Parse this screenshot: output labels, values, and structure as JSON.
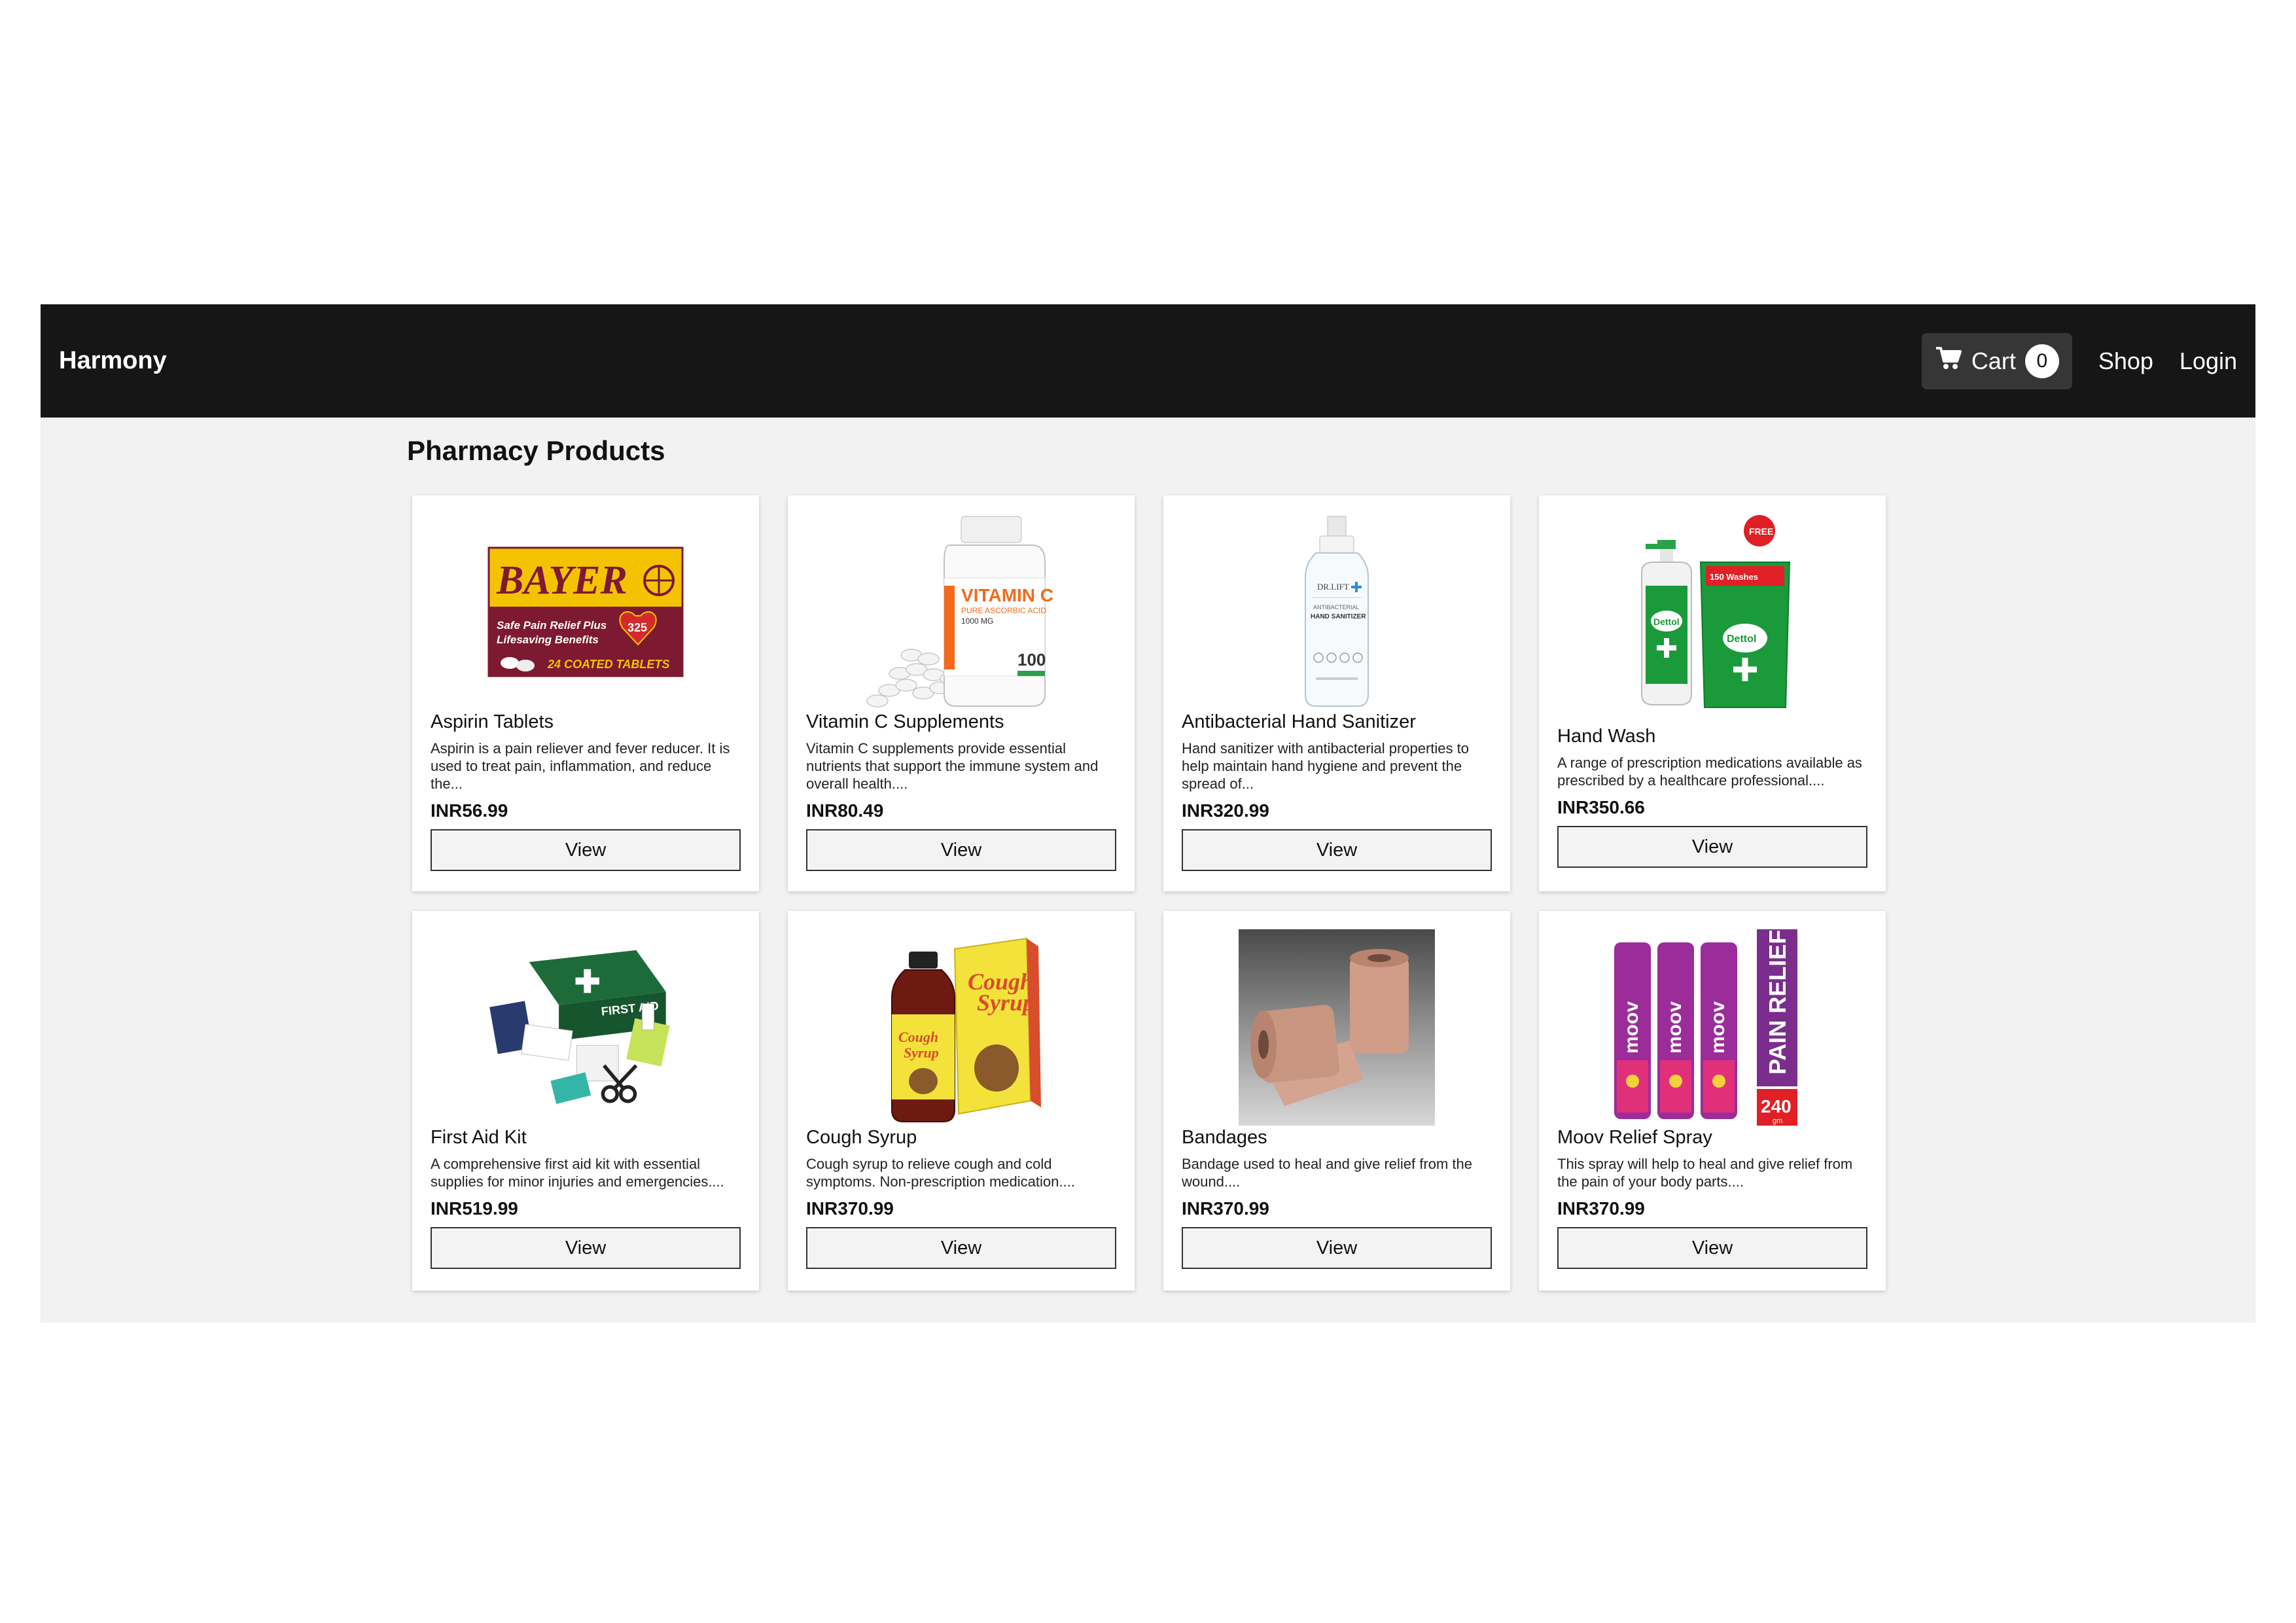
{
  "navbar": {
    "brand": "Harmony",
    "cart_label": "Cart",
    "cart_count": "0",
    "shop_label": "Shop",
    "login_label": "Login"
  },
  "page_title": "Pharmacy Products",
  "products": [
    {
      "name": "Aspirin Tablets",
      "description": "Aspirin is a pain reliever and fever reducer. It is used to treat pain, inflammation, and reduce the...",
      "price": "INR56.99",
      "view_label": "View",
      "image_text": {
        "brand": "BAYER",
        "line1": "Safe Pain Relief Plus",
        "line2": "Lifesaving Benefits",
        "strength": "325",
        "count": "24 COATED TABLETS"
      }
    },
    {
      "name": "Vitamin C Supplements",
      "description": "Vitamin C supplements provide essential nutrients that support the immune system and overall health....",
      "price": "INR80.49",
      "view_label": "View",
      "image_text": {
        "line1": "VITAMIN C",
        "line2": "PURE ASCORBIC ACID",
        "line3": "1000 MG",
        "count": "100"
      }
    },
    {
      "name": "Antibacterial Hand Sanitizer",
      "description": "Hand sanitizer with antibacterial properties to help maintain hand hygiene and prevent the spread of...",
      "price": "INR320.99",
      "view_label": "View",
      "image_text": {
        "brand": "DR.LIFT",
        "line1": "ANTIBACTERIAL",
        "line2": "HAND SANITIZER"
      }
    },
    {
      "name": "Hand Wash",
      "description": "A range of prescription medications available as prescribed by a healthcare professional....",
      "price": "INR350.66",
      "view_label": "View",
      "image_text": {
        "badge": "FREE",
        "brand": "Dettol",
        "washes": "150 Washes"
      }
    },
    {
      "name": "First Aid Kit",
      "description": "A comprehensive first aid kit with essential supplies for minor injuries and emergencies....",
      "price": "INR519.99",
      "view_label": "View",
      "image_text": {
        "label": "FIRST AID"
      }
    },
    {
      "name": "Cough Syrup",
      "description": "Cough syrup to relieve cough and cold symptoms. Non-prescription medication....",
      "price": "INR370.99",
      "view_label": "View",
      "image_text": {
        "line1": "Cough",
        "line2": "Syrup"
      }
    },
    {
      "name": "Bandages",
      "description": "Bandage used to heal and give relief from the wound....",
      "price": "INR370.99",
      "view_label": "View",
      "image_text": {}
    },
    {
      "name": "Moov Relief Spray",
      "description": "This spray will help to heal and give relief from the pain of your body parts....",
      "price": "INR370.99",
      "view_label": "View",
      "image_text": {
        "brand": "moov",
        "banner": "PAIN RELIEF",
        "size": "240",
        "unit": "gm"
      }
    }
  ],
  "colors": {
    "navbar_bg": "#161616",
    "content_bg": "#f2f2f2",
    "cart_bg": "#363636",
    "bayer_yellow": "#f3c300",
    "bayer_maroon": "#7d1930",
    "vitamin_orange": "#f26a1b",
    "dettol_green": "#1a9a3a",
    "moov_purple": "#7b2d8e"
  },
  "icons": {
    "cart": "shopping-cart-icon"
  }
}
